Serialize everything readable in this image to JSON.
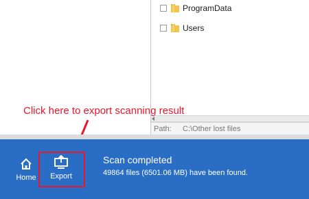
{
  "folders": [
    {
      "label": "ProgramData"
    },
    {
      "label": "Users"
    }
  ],
  "path_bar": {
    "label": "Path:",
    "value": "C:\\Other lost files"
  },
  "annotation": {
    "text": "Click here to export scanning result"
  },
  "nav": {
    "home_label": "Home",
    "export_label": "Export"
  },
  "status": {
    "title": "Scan completed",
    "detail": "49864 files (6501.06 MB) have been found."
  },
  "colors": {
    "accent_blue": "#2a6dc5",
    "annotation_red": "#e8172b"
  },
  "icons": [
    "folder-icon",
    "home-icon",
    "export-icon",
    "arrow-pointer-icon"
  ]
}
